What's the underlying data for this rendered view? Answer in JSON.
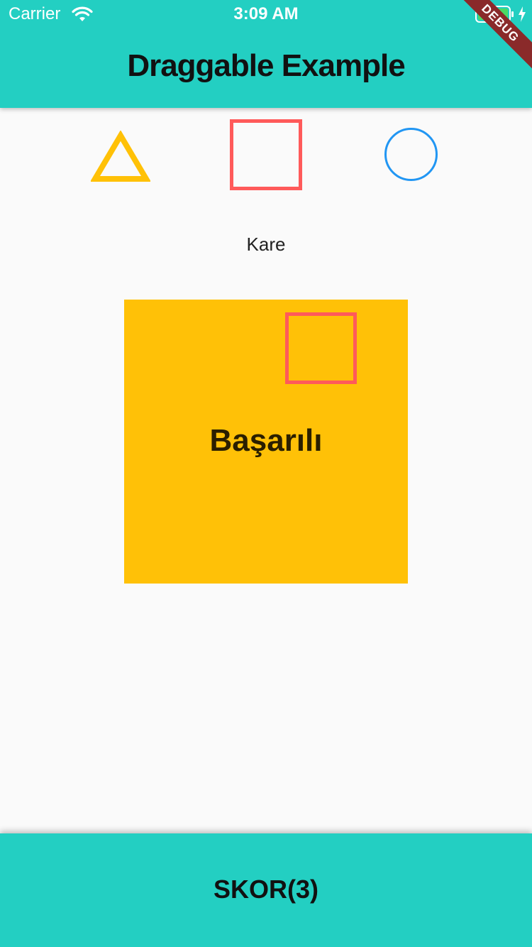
{
  "status_bar": {
    "carrier": "Carrier",
    "time": "3:09 AM",
    "wifi_icon": "wifi-icon",
    "battery_icon": "battery-icon",
    "charging_icon": "charging-bolt-icon"
  },
  "debug_banner": {
    "label": "DEBUG",
    "color": "#8a2a2a"
  },
  "app_bar": {
    "title": "Draggable Example",
    "color": "#23cfc2"
  },
  "shapes": [
    {
      "name": "triangle",
      "color": "#ffc107"
    },
    {
      "name": "square",
      "color": "#ff5a5a"
    },
    {
      "name": "circle",
      "color": "#2196f3"
    }
  ],
  "prompt": {
    "label": "Kare"
  },
  "target": {
    "result": "Başarılı",
    "color": "#ffc107"
  },
  "bottom_bar": {
    "score": "SKOR(3)",
    "color": "#23cfc2"
  }
}
